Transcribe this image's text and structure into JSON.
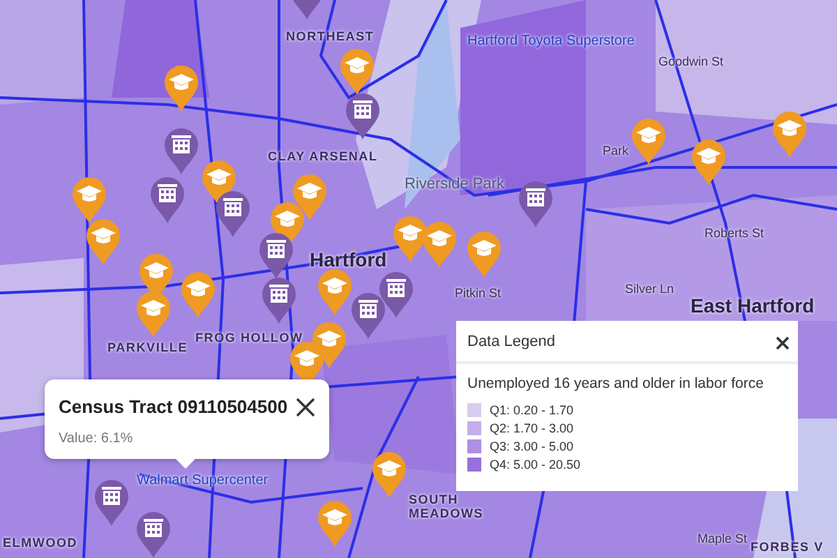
{
  "map": {
    "labels": [
      {
        "text": "NORTHEAST",
        "kind": "district"
      },
      {
        "text": "Hartford Toyota Superstore",
        "kind": "place"
      },
      {
        "text": "CLAY ARSENAL",
        "kind": "district"
      },
      {
        "text": "Riverside Park",
        "kind": "park"
      },
      {
        "text": "Hartford",
        "kind": "city"
      },
      {
        "text": "Goodwin St",
        "kind": "street"
      },
      {
        "text": "Park",
        "kind": "street"
      },
      {
        "text": "Roberts St",
        "kind": "street"
      },
      {
        "text": "Silver Ln",
        "kind": "street"
      },
      {
        "text": "East Hartford",
        "kind": "city"
      },
      {
        "text": "Pitkin St",
        "kind": "street"
      },
      {
        "text": "FROG HOLLOW",
        "kind": "district"
      },
      {
        "text": "PARKVILLE",
        "kind": "district"
      },
      {
        "text": "Walmart Supercenter",
        "kind": "place"
      },
      {
        "text": "ELMWOOD",
        "kind": "district"
      },
      {
        "text": "SOUTH MEADOWS",
        "kind": "district"
      },
      {
        "text": "Maple St",
        "kind": "street"
      },
      {
        "text": "FORBES V",
        "kind": "district"
      }
    ],
    "pins": [
      {
        "kind": "school"
      },
      {
        "kind": "school"
      },
      {
        "kind": "school"
      },
      {
        "kind": "school"
      },
      {
        "kind": "school"
      },
      {
        "kind": "school"
      },
      {
        "kind": "school"
      },
      {
        "kind": "school"
      },
      {
        "kind": "school"
      },
      {
        "kind": "school"
      },
      {
        "kind": "school"
      },
      {
        "kind": "school"
      },
      {
        "kind": "school"
      },
      {
        "kind": "school"
      },
      {
        "kind": "school"
      },
      {
        "kind": "school"
      },
      {
        "kind": "school"
      },
      {
        "kind": "school"
      },
      {
        "kind": "school"
      },
      {
        "kind": "school"
      },
      {
        "kind": "school"
      },
      {
        "kind": "building"
      },
      {
        "kind": "building"
      },
      {
        "kind": "building"
      },
      {
        "kind": "building"
      },
      {
        "kind": "building"
      },
      {
        "kind": "building"
      },
      {
        "kind": "building"
      },
      {
        "kind": "building"
      },
      {
        "kind": "building"
      },
      {
        "kind": "building"
      },
      {
        "kind": "building"
      },
      {
        "kind": "building"
      }
    ]
  },
  "popup": {
    "title": "Census Tract 09110504500",
    "value": "Value: 6.1%"
  },
  "legend": {
    "title": "Data Legend",
    "subtitle": "Unemployed 16 years and older in labor force",
    "items": [
      {
        "label": "Q1: 0.20 - 1.70",
        "color": "#d9cdef"
      },
      {
        "label": "Q2: 1.70 - 3.00",
        "color": "#c3aeea"
      },
      {
        "label": "Q3: 3.00 - 5.00",
        "color": "#ad8fe3"
      },
      {
        "label": "Q4: 5.00 - 20.50",
        "color": "#9870dc"
      }
    ]
  }
}
